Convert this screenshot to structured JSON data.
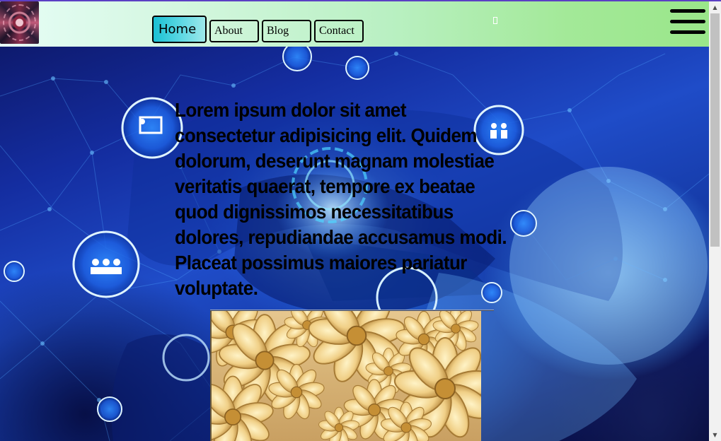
{
  "header": {
    "logo_icon": "flower-mandala-logo",
    "gradient_colors": [
      "#e6fdf6",
      "#9ae68a"
    ],
    "nav": [
      {
        "label": "Home",
        "active": true
      },
      {
        "label": "About",
        "active": false
      },
      {
        "label": "Blog",
        "active": false
      },
      {
        "label": "Contact",
        "active": false
      }
    ],
    "active_color": "#19c0d4",
    "unknown_glyph_icon": "missing-glyph-icon",
    "menu_icon": "hamburger-menu-icon"
  },
  "hero": {
    "background_image": "digital-network-laptop-blue",
    "paragraph": "Lorem ipsum dolor sit amet consectetur adipisicing elit. Quidem dolorum, deserunt magnam molestiae veritatis quaerat, tempore ex beatae quod dignissimos necessitatibus dolores, repudiandae accusamus modi. Placeat possimus maiores pariatur voluptate.",
    "image": "golden-paper-flowers"
  },
  "scrollbar": {
    "up_icon": "scroll-up-arrow-icon",
    "down_icon": "scroll-down-arrow-icon"
  }
}
